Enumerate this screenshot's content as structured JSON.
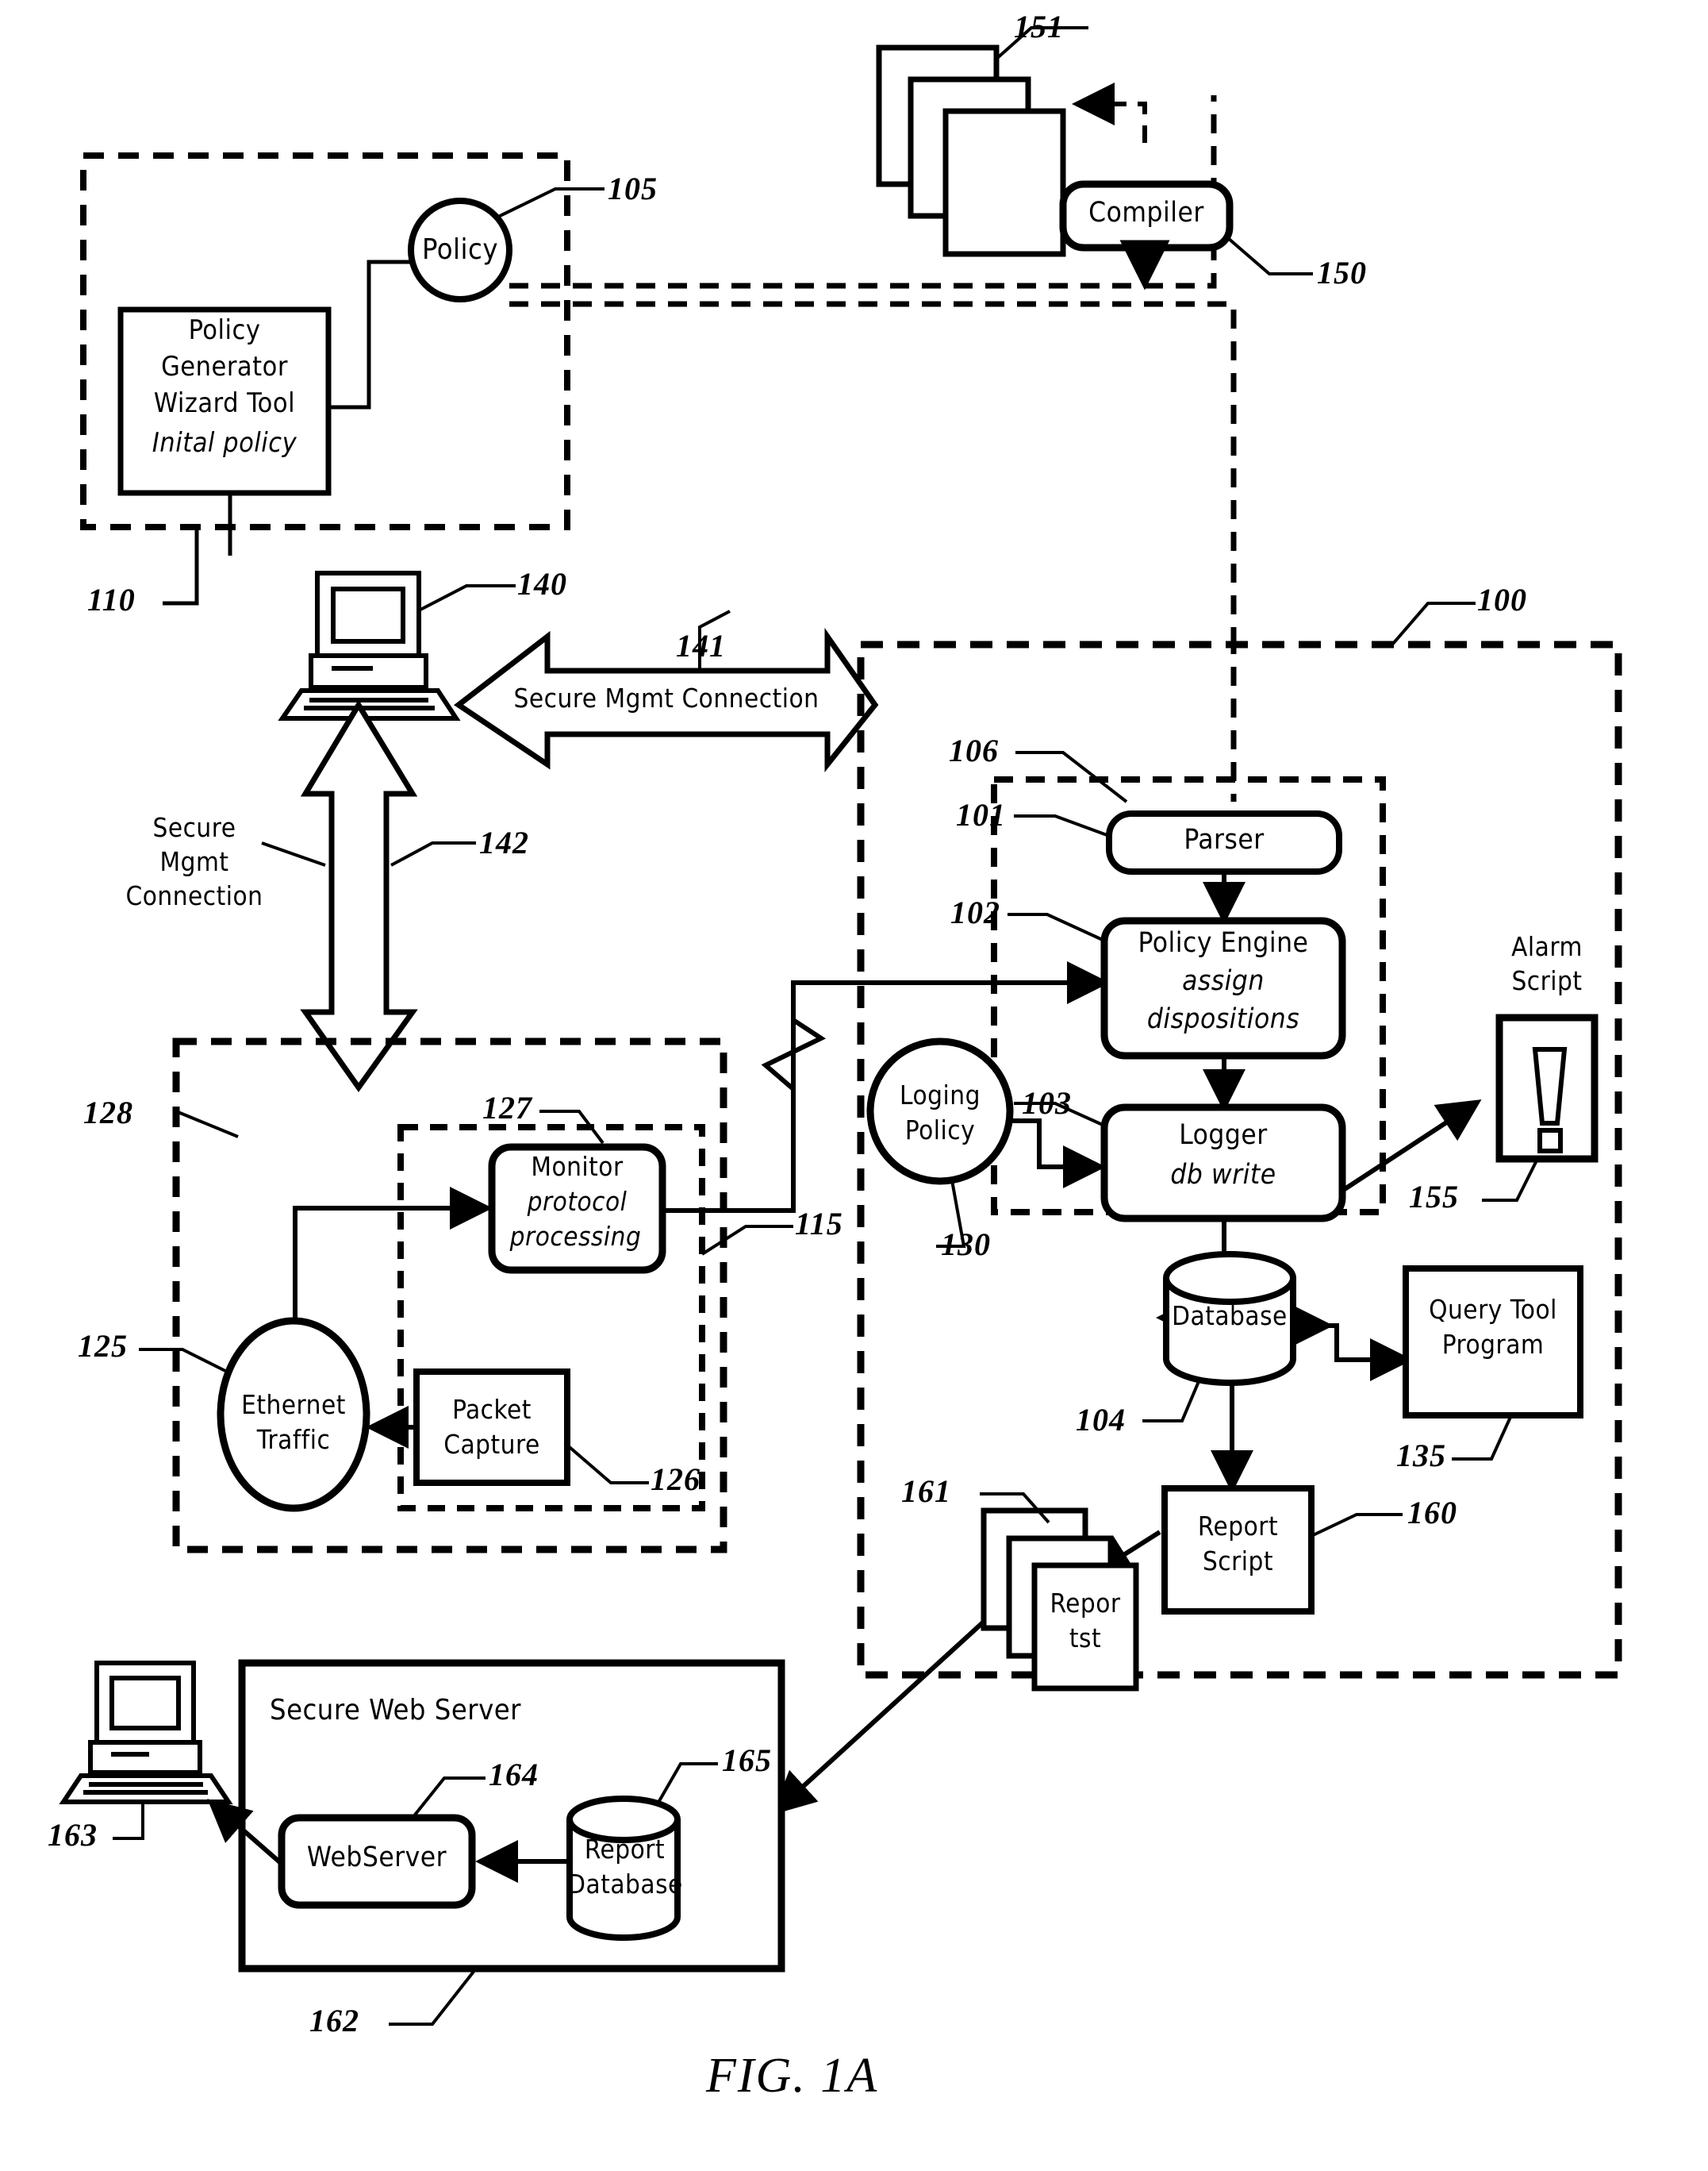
{
  "figure": {
    "caption": "FIG. 1A"
  },
  "nodes": {
    "policy_circle": "Policy",
    "policy_generator": {
      "line1": "Policy",
      "line2": "Generator",
      "line3": "Wizard Tool",
      "line4": "Inital policy"
    },
    "compiler": "Compiler",
    "documents_stack": "",
    "workstation_140": "",
    "secure_mgmt_connection_141": "Secure Mgmt Connection",
    "secure_mgmt_connection_142": {
      "line1": "Secure",
      "line2": "Mgmt",
      "line3": "Connection"
    },
    "monitor": {
      "line1": "Monitor",
      "line2": "protocol",
      "line3": "processing"
    },
    "packet_capture": {
      "line1": "Packet",
      "line2": "Capture"
    },
    "ethernet_traffic": {
      "line1": "Ethernet",
      "line2": "Traffic"
    },
    "parser": "Parser",
    "policy_engine": {
      "line1": "Policy Engine",
      "line2": "assign",
      "line3": "dispositions"
    },
    "logger": {
      "line1": "Logger",
      "line2": "db write"
    },
    "loging_policy": {
      "line1": "Loging",
      "line2": "Policy"
    },
    "alarm_script": {
      "line1": "Alarm",
      "line2": "Script",
      "glyph": "!"
    },
    "database": "Database",
    "query_tool": {
      "line1": "Query Tool",
      "line2": "Program"
    },
    "report_script": {
      "line1": "Report",
      "line2": "Script"
    },
    "reports_stack": {
      "line1": "Repor",
      "line2": "tst"
    },
    "secure_web_server": "Secure Web Server",
    "webserver": "WebServer",
    "report_database": {
      "line1": "Report",
      "line2": "Database"
    },
    "client_workstation_163": ""
  },
  "reference_numerals": {
    "n100": "100",
    "n101": "101",
    "n102": "102",
    "n103": "103",
    "n104": "104",
    "n105": "105",
    "n106": "106",
    "n110": "110",
    "n115": "115",
    "n125": "125",
    "n126": "126",
    "n127": "127",
    "n128": "128",
    "n130": "130",
    "n135": "135",
    "n140": "140",
    "n141": "141",
    "n142": "142",
    "n150": "150",
    "n151": "151",
    "n155": "155",
    "n160": "160",
    "n161": "161",
    "n162": "162",
    "n163": "163",
    "n164": "164",
    "n165": "165"
  },
  "colors": {
    "ink": "#000000",
    "paper": "#ffffff"
  }
}
